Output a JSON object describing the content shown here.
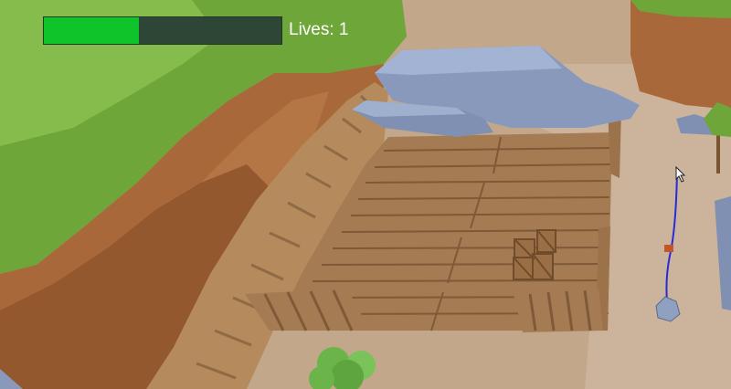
{
  "hud": {
    "lives_label": "Lives: 1",
    "health_level": 0.4,
    "health_color": "#0fc42a",
    "health_track_color": "#2d4636"
  },
  "scene": {
    "terrain_colors": {
      "grass": "#6ea63a",
      "cliff": "#a9683a",
      "ground": "#c2a78a",
      "wood": "#a47b52",
      "rock": "#8899bb"
    },
    "rope_color": "#2a2ad8",
    "cursor": "arrow-cursor-icon"
  }
}
